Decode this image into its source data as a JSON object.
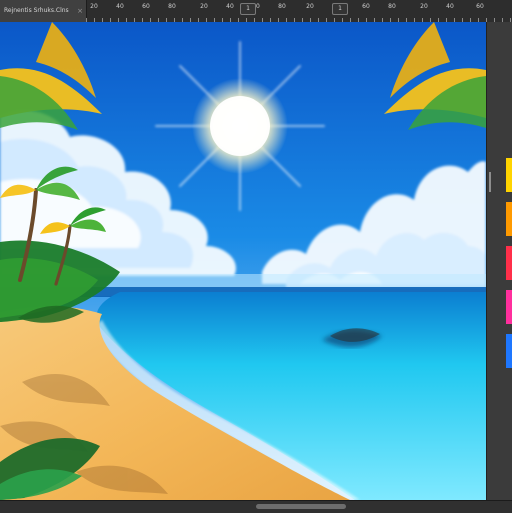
{
  "document_tab": {
    "title": "Rejnentis Srhuks.Clns",
    "close": "×"
  },
  "ruler": {
    "labels": [
      "20",
      "40",
      "60",
      "80",
      "20",
      "40",
      "60",
      "80",
      "20",
      "40",
      "60",
      "80",
      "20",
      "40",
      "60"
    ],
    "boxes": [
      "1",
      "1"
    ]
  },
  "swatches": [
    "#ffd400",
    "#ff9a00",
    "#ff2f4a",
    "#ff2f9d",
    "#1e77ff"
  ],
  "icons": {
    "close": "close-icon",
    "scroll": "scrollbar-thumb"
  }
}
